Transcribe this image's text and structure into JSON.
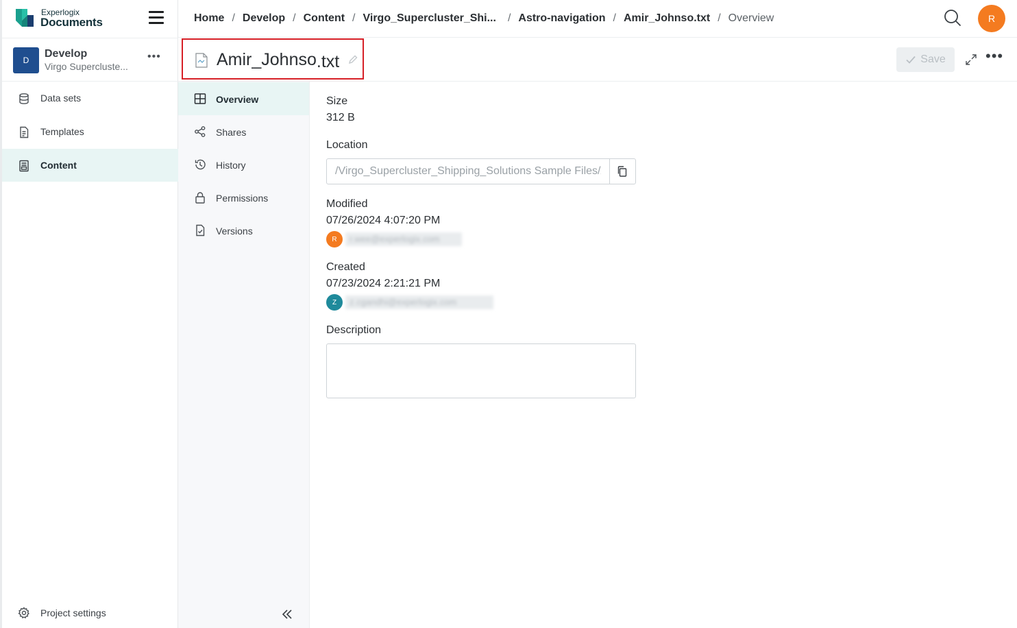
{
  "brand": {
    "small": "Experlogix",
    "big": "Documents"
  },
  "project": {
    "avatar_letter": "D",
    "name": "Develop",
    "subtitle": "Virgo Supercluste...",
    "more": "•••"
  },
  "sidebar": {
    "items": [
      {
        "label": "Data sets",
        "icon": "database-icon",
        "active": false
      },
      {
        "label": "Templates",
        "icon": "template-icon",
        "active": false
      },
      {
        "label": "Content",
        "icon": "content-icon",
        "active": true
      }
    ],
    "settings_label": "Project settings"
  },
  "breadcrumb": {
    "items": [
      "Home",
      "Develop",
      "Content",
      "Virgo_Supercluster_Shi...",
      "Astro-navigation",
      "Amir_Johnso.txt"
    ],
    "current": "Overview",
    "separator": "/"
  },
  "user": {
    "initial": "R",
    "color": "#f47b20"
  },
  "file": {
    "name": "Amir_Johnso",
    "ext": ".txt"
  },
  "toolbar": {
    "save_label": "Save"
  },
  "subnav": {
    "items": [
      {
        "label": "Overview",
        "icon": "grid-icon",
        "active": true
      },
      {
        "label": "Shares",
        "icon": "share-icon",
        "active": false
      },
      {
        "label": "History",
        "icon": "history-icon",
        "active": false
      },
      {
        "label": "Permissions",
        "icon": "lock-icon",
        "active": false
      },
      {
        "label": "Versions",
        "icon": "versions-icon",
        "active": false
      }
    ]
  },
  "details": {
    "size_label": "Size",
    "size_value": "312 B",
    "location_label": "Location",
    "location_value": "/Virgo_Supercluster_Shipping_Solutions Sample Files/Astro-navigation/Amir_Johnso.txt",
    "modified_label": "Modified",
    "modified_value": "07/26/2024 4:07:20 PM",
    "modified_user_initial": "R",
    "modified_user_email": "r.wee@experlogix.com",
    "created_label": "Created",
    "created_value": "07/23/2024 2:21:21 PM",
    "created_user_initial": "Z",
    "created_user_email": "z.cgandhi@experlogix.com",
    "description_label": "Description",
    "description_value": ""
  },
  "colors": {
    "accent": "#1a8a7e",
    "active_bg": "#e8f5f4",
    "highlight_border": "#d61f26",
    "project_avatar": "#1f4e8f",
    "created_avatar": "#1f8a9b"
  }
}
